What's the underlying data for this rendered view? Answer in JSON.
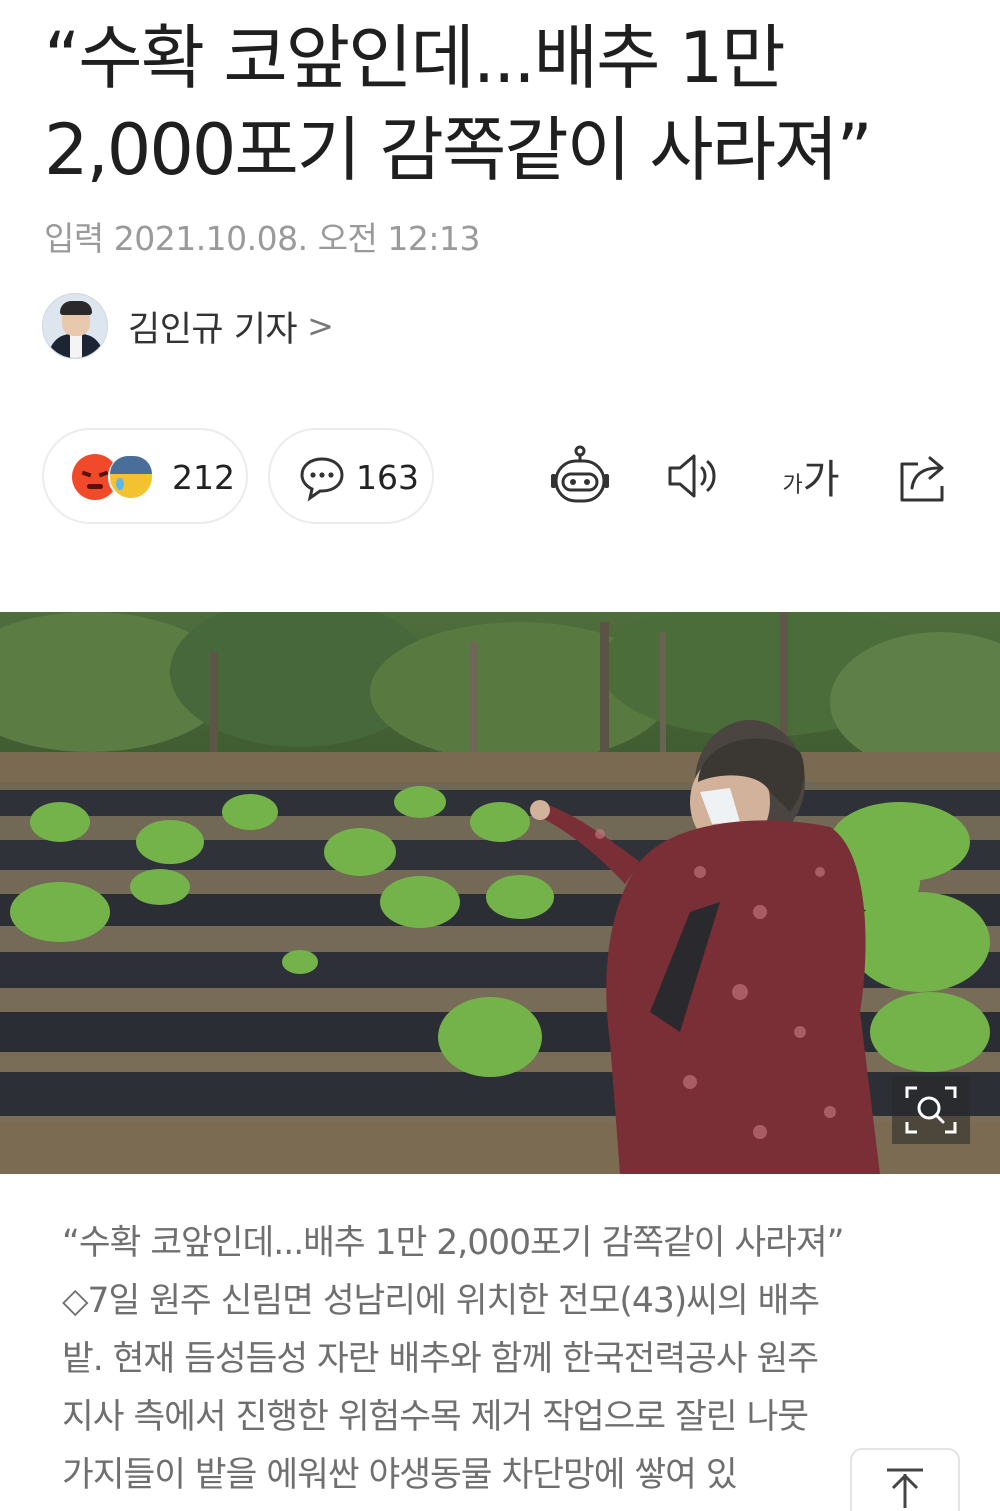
{
  "article": {
    "headline_line1": "“수확 코앞인데...배추 1만",
    "headline_line2": "2,000포기 감쪽같이 사라져”",
    "date": "입력 2021.10.08. 오전 12:13",
    "author": "김인규 기자",
    "author_chevron": ">"
  },
  "actions": {
    "reaction_count": "212",
    "comment_count": "163",
    "font_size_small": "가",
    "font_size_big": "가",
    "tools": [
      "robot-icon",
      "speaker-icon",
      "font-size-icon",
      "share-icon"
    ]
  },
  "photo": {
    "caption_lines": [
      "“수확 코앞인데...배추 1만 2,000포기 감쪽같이 사라져”",
      "◇7일 원주 신림면 성남리에 위치한 전모(43)씨의 배추",
      "밭. 현재 듬성듬성 자란 배추와 함께 한국전력공사 원주",
      "지사 측에서 진행한 위험수목 제거 작업으로 잘린 나뭇",
      "가지들이 밭을 에워싼 야생동물 차단망에 쌓여 있"
    ]
  },
  "colors": {
    "text_primary": "#1f1f1f",
    "text_muted": "#9a9a9a",
    "caption": "#6f6f6f",
    "pill_border": "#ececec"
  }
}
